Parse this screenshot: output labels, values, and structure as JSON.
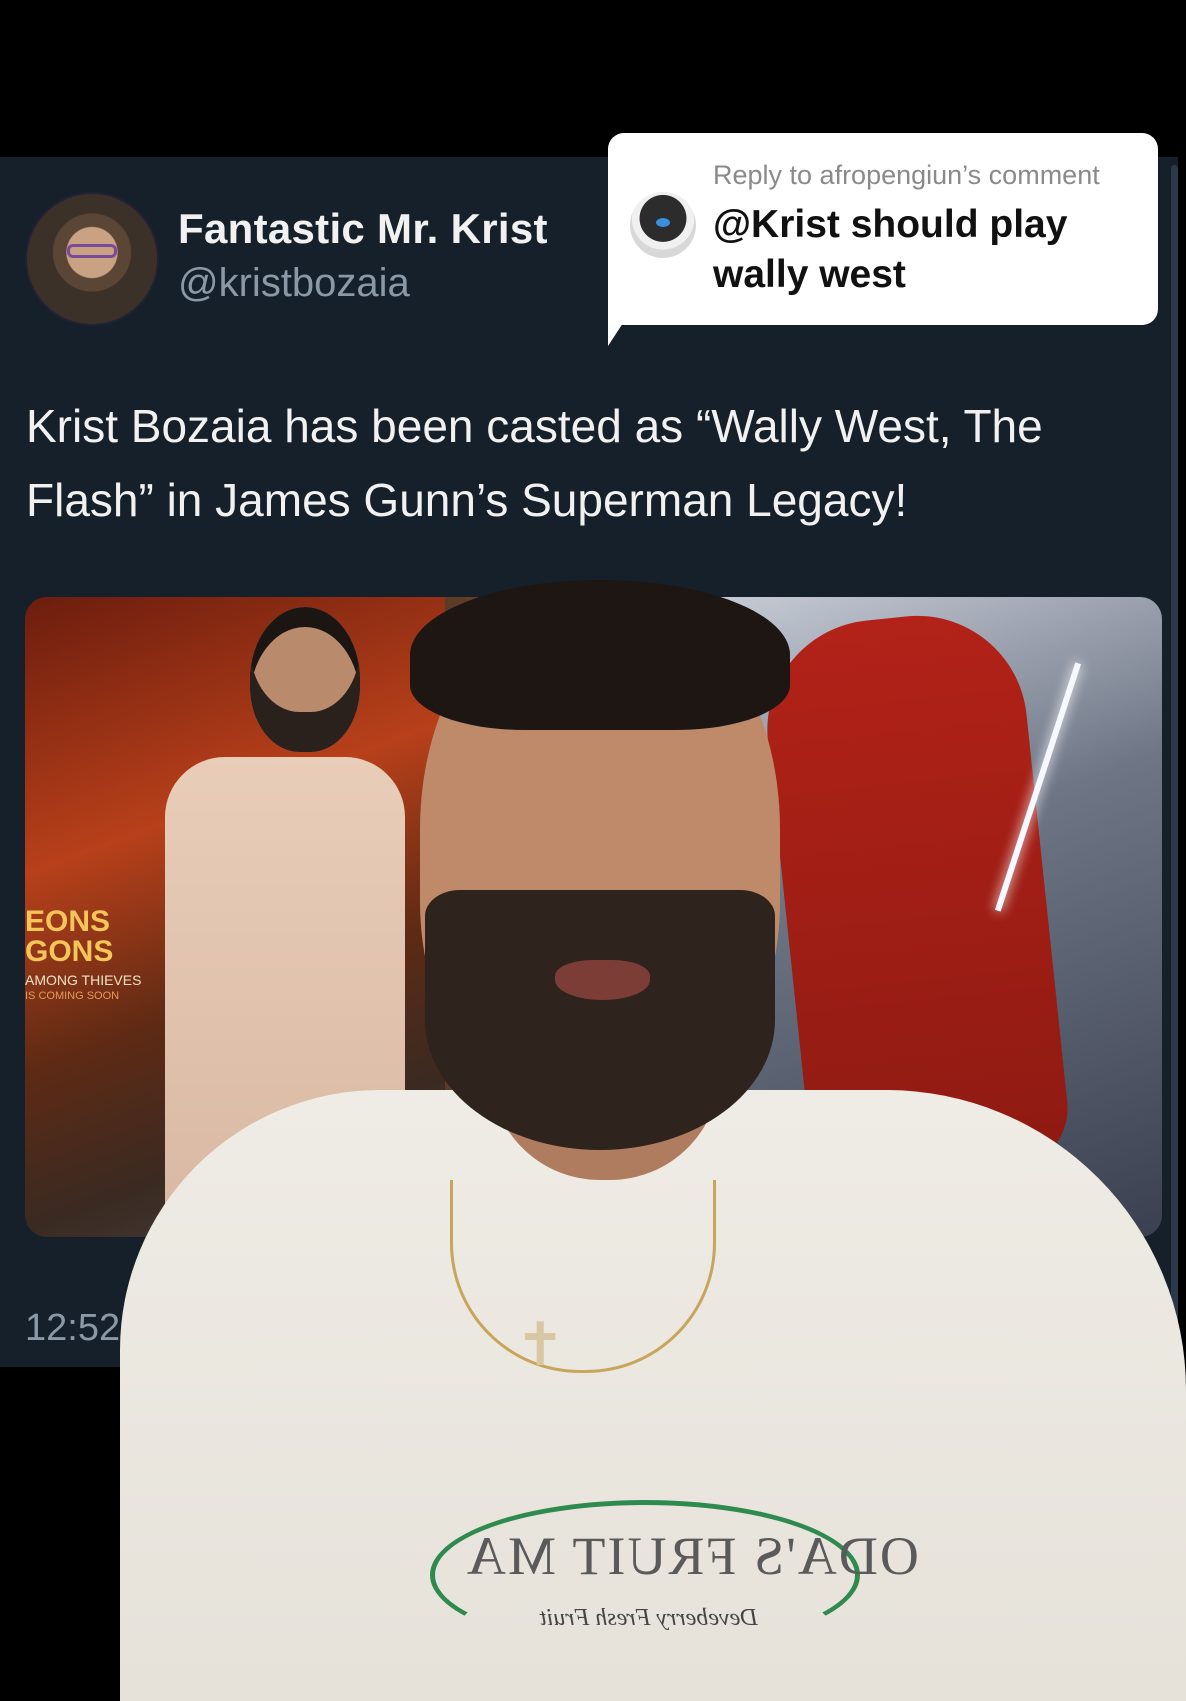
{
  "tweet": {
    "display_name": "Fantastic Mr. Krist",
    "handle": "@kristbozaia",
    "text": "Krist Bozaia has been casted as “Wally West, The Flash” in James Gunn’s Superman Legacy!",
    "timestamp": "12:52 P",
    "media": {
      "poster_title": "EONS\nGONS",
      "poster_subtitle": "AMONG THIEVES",
      "poster_tagline": "IS COMING SOON"
    }
  },
  "reply": {
    "caption": "Reply to afropengiun’s comment",
    "text": "@Krist should play wally west"
  },
  "presenter": {
    "shirt_logo_text": "ODA'S FRUIT MA",
    "shirt_logo_script": "Deveberry Fresh Fruit"
  },
  "colors": {
    "tweet_background": "#15202b",
    "secondary_text": "#8b98a5",
    "reply_bubble": "#ffffff"
  }
}
